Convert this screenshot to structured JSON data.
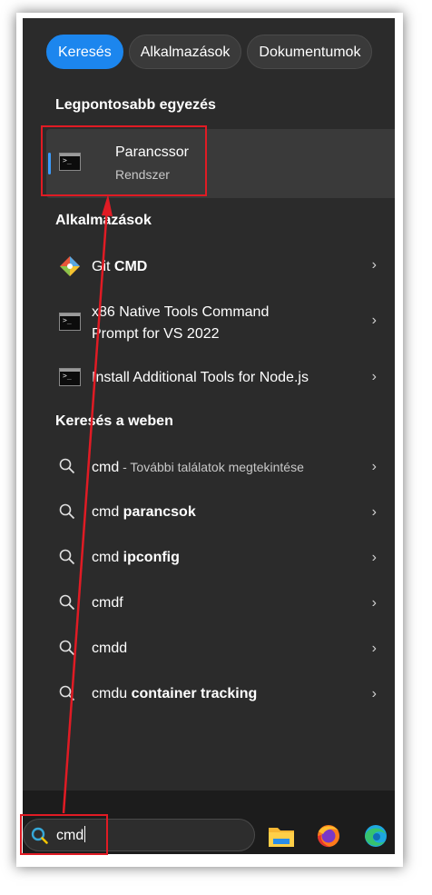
{
  "tabs": [
    {
      "label": "Keresés",
      "active": true
    },
    {
      "label": "Alkalmazások",
      "active": false
    },
    {
      "label": "Dokumentumok",
      "active": false
    }
  ],
  "sections": {
    "best_match": "Legpontosabb egyezés",
    "apps": "Alkalmazások",
    "web": "Keresés a weben"
  },
  "best_match": {
    "title": "Parancssor",
    "subtitle": "Rendszer",
    "icon": "command-prompt-icon"
  },
  "apps": [
    {
      "label": "Git CMD",
      "label_plain": "Git ",
      "label_bold": "CMD",
      "icon": "git-icon"
    },
    {
      "line1": "x86 Native Tools Command",
      "line2": "Prompt for VS 2022",
      "icon": "command-prompt-icon"
    },
    {
      "label": "Install Additional Tools for Node.js",
      "icon": "command-prompt-icon"
    }
  ],
  "web": [
    {
      "plain": "cmd",
      "bold": "",
      "hint": " - További találatok megtekintése"
    },
    {
      "plain": "cmd ",
      "bold": "parancsok",
      "hint": ""
    },
    {
      "plain": "cmd ",
      "bold": "ipconfig",
      "hint": ""
    },
    {
      "plain": "cmdf",
      "bold": "",
      "hint": ""
    },
    {
      "plain": "cmdd",
      "bold": "",
      "hint": ""
    },
    {
      "plain": "cmdu ",
      "bold": "container tracking",
      "hint": ""
    }
  ],
  "chevron": "›",
  "taskbar": {
    "search_value": "cmd",
    "icons": [
      "file-explorer-icon",
      "firefox-icon",
      "edge-icon"
    ]
  },
  "colors": {
    "accent": "#1c86ee",
    "panel": "#2b2b2b",
    "annotation": "#e01b24"
  }
}
